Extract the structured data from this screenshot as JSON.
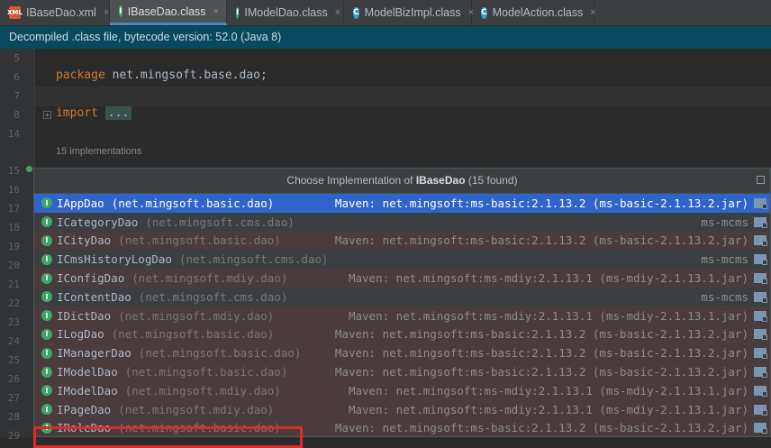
{
  "tabs": [
    {
      "label": "IBaseDao.xml",
      "icon": "xml-file-icon",
      "badge": "XML",
      "active": false
    },
    {
      "label": "IBaseDao.class",
      "icon": "interface-icon",
      "badge": "I",
      "active": true
    },
    {
      "label": "IModelDao.class",
      "icon": "interface-icon",
      "badge": "I",
      "active": false
    },
    {
      "label": "ModelBizImpl.class",
      "icon": "class-icon",
      "badge": "C",
      "active": false
    },
    {
      "label": "ModelAction.class",
      "icon": "class-icon",
      "badge": "C",
      "active": false
    }
  ],
  "close_glyph": "×",
  "banner": "Decompiled .class file, bytecode version: 52.0 (Java 8)",
  "editor": {
    "line_numbers": [
      "5",
      "6",
      "7",
      "8",
      "14",
      "15",
      "16",
      "17",
      "18",
      "19",
      "20",
      "21",
      "22",
      "23",
      "24",
      "25",
      "26",
      "27",
      "28",
      "29"
    ],
    "package_kw": "package",
    "package_name": " net.mingsoft.base.dao;",
    "import_kw": "import",
    "import_folded": "...",
    "impl_hint": "15 implementations"
  },
  "popup": {
    "title_prefix": "Choose Implementation of ",
    "title_bold": "IBaseDao",
    "title_suffix": " (15 found)",
    "rows": [
      {
        "name": "IAppDao",
        "pkg": "(net.mingsoft.basic.dao)",
        "lib": "Maven: net.mingsoft:ms-basic:2.1.13.2 (ms-basic-2.1.13.2.jar)",
        "style": "sel"
      },
      {
        "name": "ICategoryDao",
        "pkg": "(net.mingsoft.cms.dao)",
        "lib": "ms-mcms",
        "style": ""
      },
      {
        "name": "ICityDao",
        "pkg": "(net.mingsoft.basic.dao)",
        "lib": "Maven: net.mingsoft:ms-basic:2.1.13.2 (ms-basic-2.1.13.2.jar)",
        "style": "alt"
      },
      {
        "name": "ICmsHistoryLogDao",
        "pkg": "(net.mingsoft.cms.dao)",
        "lib": "ms-mcms",
        "style": ""
      },
      {
        "name": "IConfigDao",
        "pkg": "(net.mingsoft.mdiy.dao)",
        "lib": "Maven: net.mingsoft:ms-mdiy:2.1.13.1 (ms-mdiy-2.1.13.1.jar)",
        "style": "alt"
      },
      {
        "name": "IContentDao",
        "pkg": "(net.mingsoft.cms.dao)",
        "lib": "ms-mcms",
        "style": ""
      },
      {
        "name": "IDictDao",
        "pkg": "(net.mingsoft.mdiy.dao)",
        "lib": "Maven: net.mingsoft:ms-mdiy:2.1.13.1 (ms-mdiy-2.1.13.1.jar)",
        "style": "alt"
      },
      {
        "name": "ILogDao",
        "pkg": "(net.mingsoft.basic.dao)",
        "lib": "Maven: net.mingsoft:ms-basic:2.1.13.2 (ms-basic-2.1.13.2.jar)",
        "style": "alt"
      },
      {
        "name": "IManagerDao",
        "pkg": "(net.mingsoft.basic.dao)",
        "lib": "Maven: net.mingsoft:ms-basic:2.1.13.2 (ms-basic-2.1.13.2.jar)",
        "style": "alt"
      },
      {
        "name": "IModelDao",
        "pkg": "(net.mingsoft.basic.dao)",
        "lib": "Maven: net.mingsoft:ms-basic:2.1.13.2 (ms-basic-2.1.13.2.jar)",
        "style": "alt"
      },
      {
        "name": "IModelDao",
        "pkg": "(net.mingsoft.mdiy.dao)",
        "lib": "Maven: net.mingsoft:ms-mdiy:2.1.13.1 (ms-mdiy-2.1.13.1.jar)",
        "style": "alt"
      },
      {
        "name": "IPageDao",
        "pkg": "(net.mingsoft.mdiy.dao)",
        "lib": "Maven: net.mingsoft:ms-mdiy:2.1.13.1 (ms-mdiy-2.1.13.1.jar)",
        "style": "alt"
      },
      {
        "name": "IRoleDao",
        "pkg": "(net.mingsoft.basic.dao)",
        "lib": "Maven: net.mingsoft:ms-basic:2.1.13.2 (ms-basic-2.1.13.2.jar)",
        "style": "alt"
      }
    ]
  },
  "colors": {
    "accent": "#2f65ca",
    "banner": "#08495e",
    "highlight_border": "#e02a2a"
  }
}
